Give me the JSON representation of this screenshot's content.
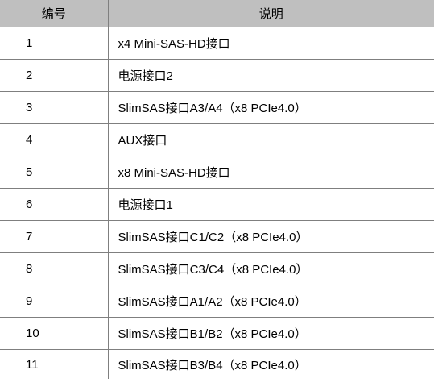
{
  "table": {
    "headers": [
      "编号",
      "说明"
    ],
    "rows": [
      {
        "num": "1",
        "desc": "x4 Mini-SAS-HD接口"
      },
      {
        "num": "2",
        "desc": "电源接口2"
      },
      {
        "num": "3",
        "desc": "SlimSAS接口A3/A4（x8 PCIe4.0）"
      },
      {
        "num": "4",
        "desc": "AUX接口"
      },
      {
        "num": "5",
        "desc": "x8 Mini-SAS-HD接口"
      },
      {
        "num": "6",
        "desc": "电源接口1"
      },
      {
        "num": "7",
        "desc": "SlimSAS接口C1/C2（x8 PCIe4.0）"
      },
      {
        "num": "8",
        "desc": "SlimSAS接口C3/C4（x8 PCIe4.0）"
      },
      {
        "num": "9",
        "desc": "SlimSAS接口A1/A2（x8 PCIe4.0）"
      },
      {
        "num": "10",
        "desc": "SlimSAS接口B1/B2（x8 PCIe4.0）"
      },
      {
        "num": "11",
        "desc": "SlimSAS接口B3/B4（x8 PCIe4.0）"
      }
    ]
  }
}
